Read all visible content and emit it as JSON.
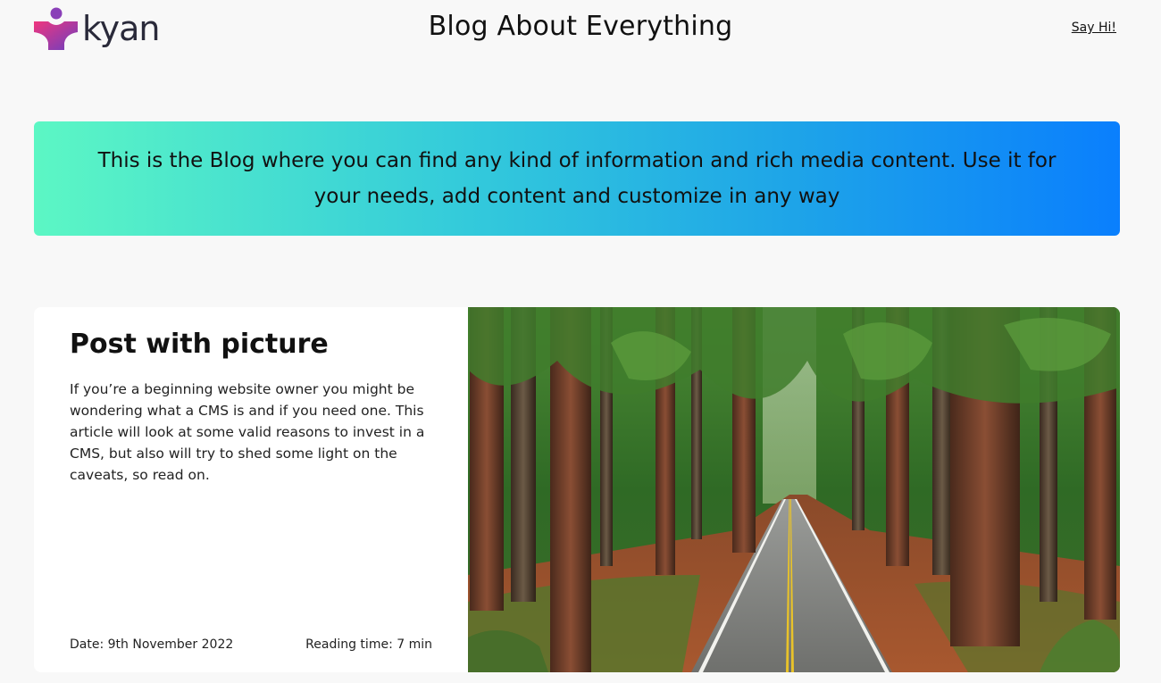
{
  "header": {
    "logo_text": "kyan",
    "site_title": "Blog About Everything",
    "nav_link": "Say Hi!"
  },
  "hero": {
    "text": "This is the Blog where you can find any kind of information and rich media content. Use it for your needs, add content and customize in any way"
  },
  "post": {
    "title": "Post with picture",
    "excerpt": "If you’re a beginning website owner you might be wondering what a CMS is and if you need one. This article will look at some valid reasons to invest in a CMS, but also will try to shed some light on the caveats, so read on.",
    "date": "Date: 9th November 2022",
    "reading_time": "Reading time: 7 min",
    "image_subject": "redwood-forest-road"
  },
  "colors": {
    "hero_gradient_start": "#5cf7c4",
    "hero_gradient_end": "#0a7ffd",
    "logo_pink": "#e0398c",
    "logo_purple": "#7b3fb8"
  }
}
